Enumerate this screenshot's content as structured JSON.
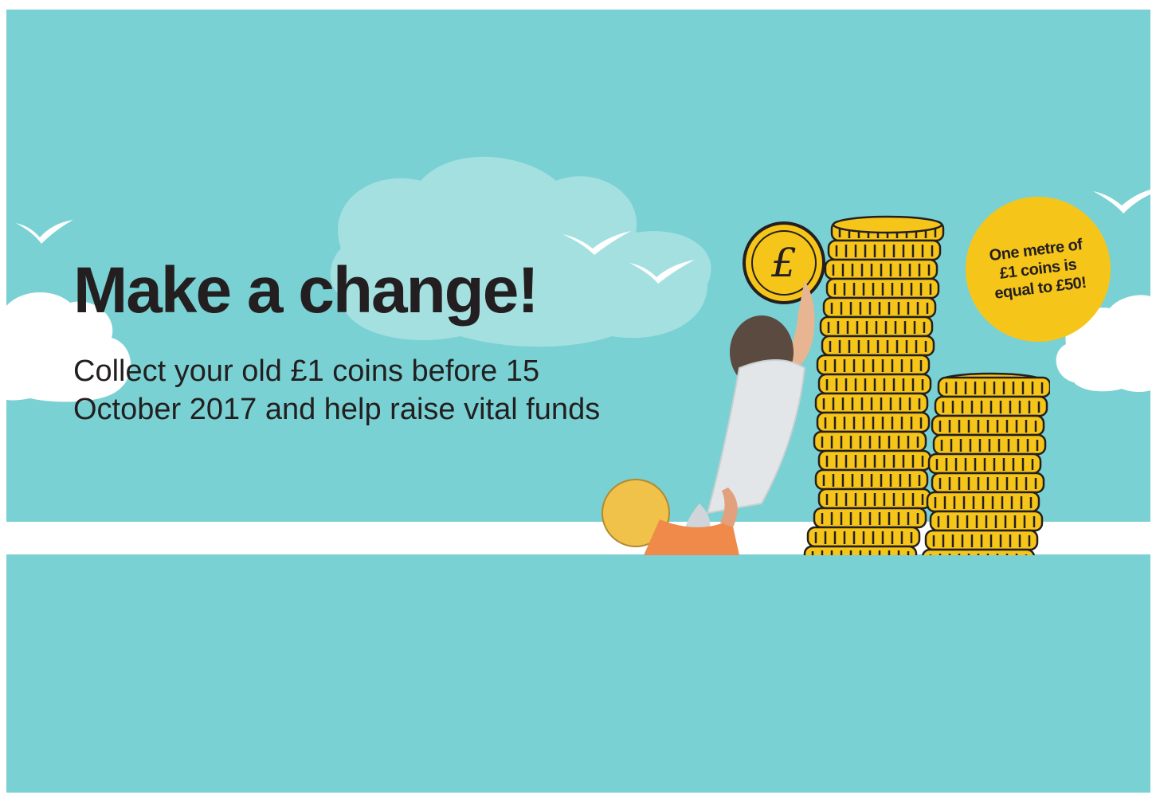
{
  "banner": {
    "headline": "Make a change!",
    "subline_lines": [
      "Collect your old £1 coins before 15",
      "October 2017 and help raise vital funds"
    ],
    "badge_lines": [
      "One metre of",
      "£1 coins is",
      "equal to £50!"
    ],
    "coin_symbol": "£"
  },
  "colors": {
    "sky": "#7ad1d3",
    "cloud": "#ffffff",
    "cloud_pale": "#a5e0e1",
    "coin_gold": "#f6c519",
    "text_dark": "#231f20"
  },
  "icons": [
    "bird-icon",
    "cloud-shape",
    "coin-icon",
    "pound-sign-icon"
  ]
}
